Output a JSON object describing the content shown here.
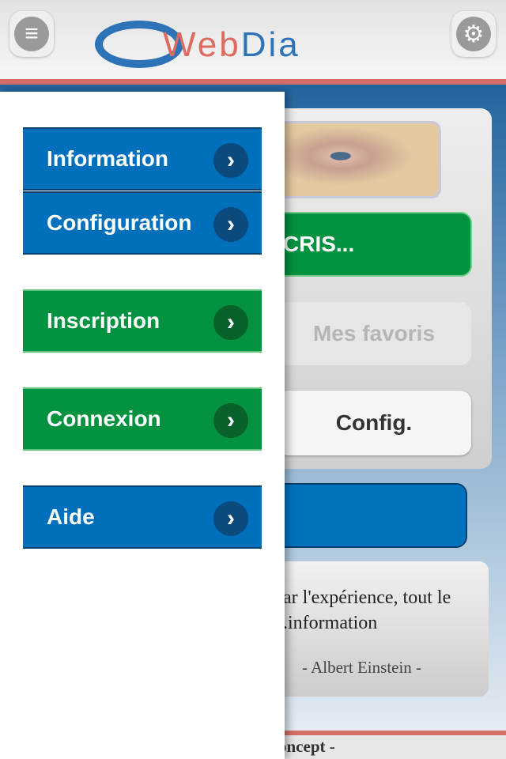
{
  "header": {
    "logo_part1": "Web",
    "logo_part2": "Dia",
    "menu_icon": "hamburger-icon",
    "settings_icon": "gear-icon"
  },
  "colors": {
    "blue": "#0070bd",
    "green": "#03923f",
    "accent_red": "#d56e66"
  },
  "main": {
    "green_button": "CRIS...",
    "favorites_button": "Mes favoris",
    "config_button": "Config.",
    "quote_text": "ar l'expérience, tout le information.",
    "quote_line1": "ar l'expérience, tout le",
    "quote_line2": "information.",
    "quote_author": "- Albert Einstein -"
  },
  "footer": {
    "text": "oncept -"
  },
  "drawer": {
    "items": [
      {
        "label": "Information",
        "color": "blue"
      },
      {
        "label": "Configuration",
        "color": "blue"
      },
      {
        "label": "Inscription",
        "color": "green"
      },
      {
        "label": "Connexion",
        "color": "green"
      },
      {
        "label": "Aide",
        "color": "blue"
      }
    ]
  }
}
